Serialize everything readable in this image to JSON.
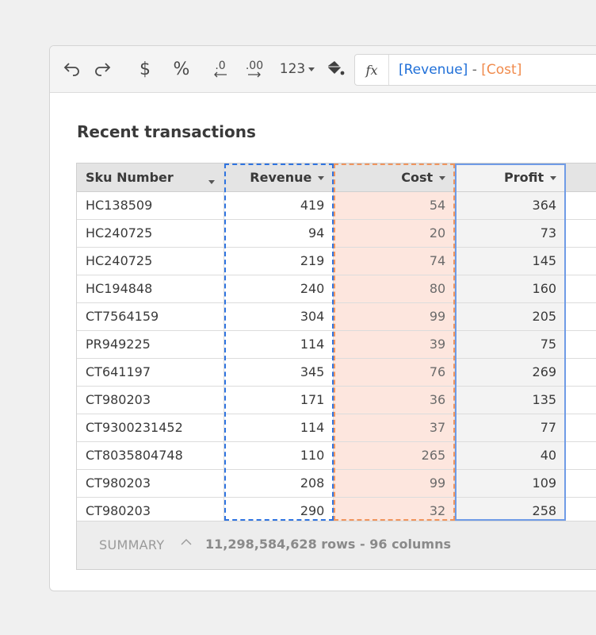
{
  "toolbar": {
    "undo_icon": "undo-icon",
    "redo_icon": "redo-icon",
    "currency_symbol": "$",
    "percent_symbol": "%",
    "decrease_decimal_label": ".0",
    "increase_decimal_label": ".00",
    "number_format_label": "123",
    "fill_icon": "paint-bucket-icon"
  },
  "formula": {
    "fx_label": "fx",
    "ref1": "[Revenue]",
    "operator": " - ",
    "ref2": "[Cost]"
  },
  "title": "Recent transactions",
  "columns": [
    "Sku Number",
    "Revenue",
    "Cost",
    "Profit"
  ],
  "rows": [
    [
      "HC138509",
      "419",
      "54",
      "364"
    ],
    [
      "HC240725",
      "94",
      "20",
      "73"
    ],
    [
      "HC240725",
      "219",
      "74",
      "145"
    ],
    [
      "HC194848",
      "240",
      "80",
      "160"
    ],
    [
      "CT7564159",
      "304",
      "99",
      "205"
    ],
    [
      "PR949225",
      "114",
      "39",
      "75"
    ],
    [
      "CT641197",
      "345",
      "76",
      "269"
    ],
    [
      "CT980203",
      "171",
      "36",
      "135"
    ],
    [
      "CT9300231452",
      "114",
      "37",
      "77"
    ],
    [
      "CT8035804748",
      "110",
      "265",
      "40"
    ],
    [
      "CT980203",
      "208",
      "99",
      "109"
    ],
    [
      "CT980203",
      "290",
      "32",
      "258"
    ]
  ],
  "summary": {
    "label": "SUMMARY",
    "info": "11,298,584,628 rows - 96 columns"
  },
  "colors": {
    "revenue_ref": "#1f6fd8",
    "cost_ref": "#f08a4b",
    "cost_fill": "#fde6de"
  }
}
